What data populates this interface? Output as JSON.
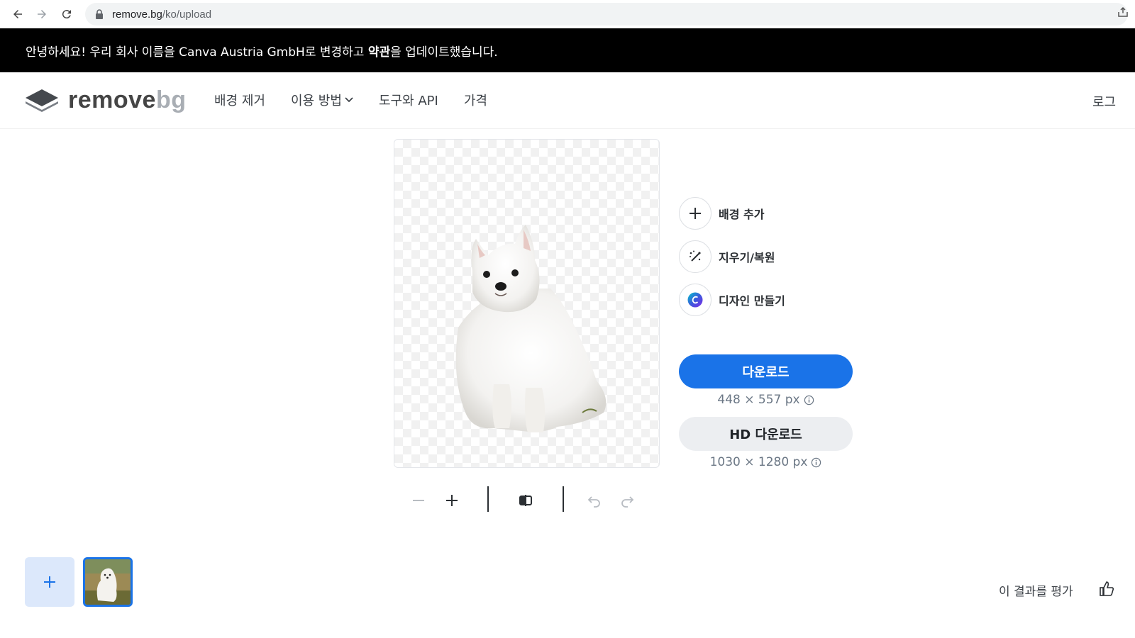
{
  "browser": {
    "url_host": "remove.bg",
    "url_path": "/ko/upload"
  },
  "announcement": {
    "text_part1": "안녕하세요! 우리 회사 이름을 Canva Austria GmbH로 변경하고 ",
    "text_bold": "약관",
    "text_part2": "을 업데이트했습니다."
  },
  "header": {
    "logo_primary": "remove",
    "logo_secondary": "bg",
    "nav": [
      {
        "label": "배경 제거"
      },
      {
        "label": "이용 방법"
      },
      {
        "label": "도구와 API"
      },
      {
        "label": "가격"
      }
    ],
    "login_label": "로그"
  },
  "editor": {
    "actions": [
      {
        "label": "배경 추가",
        "icon": "plus-icon"
      },
      {
        "label": "지우기/복원",
        "icon": "magic-brush-icon"
      },
      {
        "label": "디자인 만들기",
        "icon": "canva-icon"
      }
    ],
    "download_label": "다운로드",
    "download_size": "448 × 557 px",
    "hd_download_label": "HD 다운로드",
    "hd_download_size": "1030 × 1280 px"
  },
  "footer": {
    "rate_label": "이 결과를 평가"
  },
  "colors": {
    "primary": "#1a73e8",
    "announcement_bg": "#000000",
    "secondary_button": "#eceef1"
  }
}
